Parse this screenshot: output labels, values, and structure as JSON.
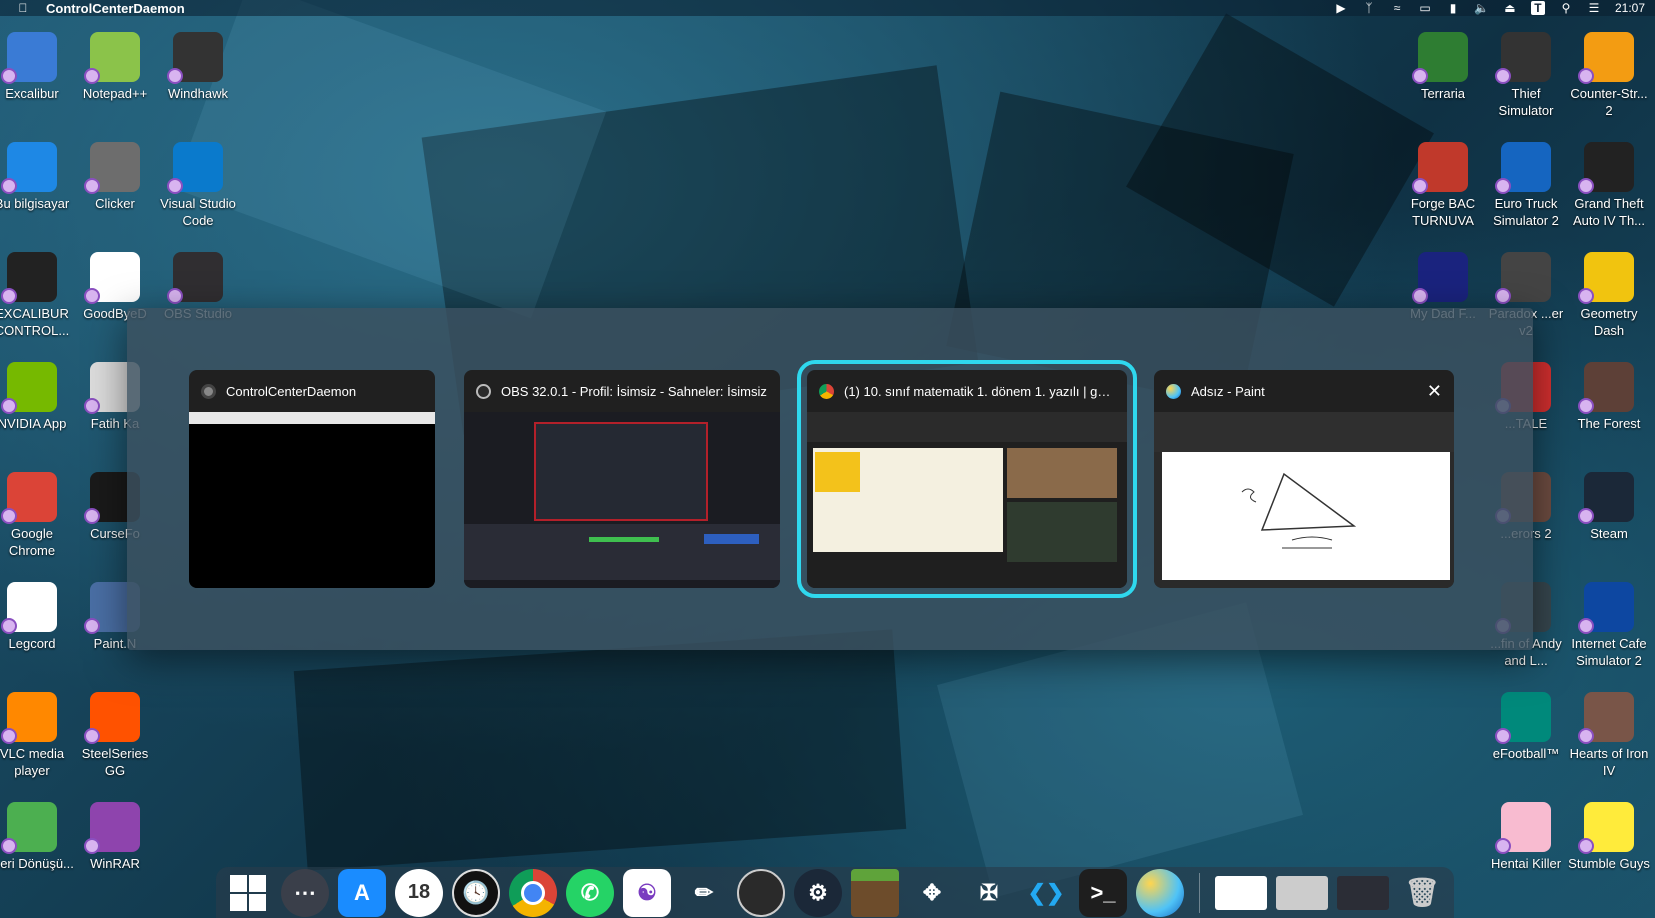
{
  "menubar": {
    "app_title": "ControlCenterDaemon",
    "clock": "21:07",
    "status_icons": [
      "play-circle-icon",
      "bluetooth-icon",
      "wifi-icon",
      "display-icon",
      "battery-icon",
      "volume-icon",
      "eject-icon",
      "keyboard-t-icon",
      "search-icon",
      "control-center-icon"
    ]
  },
  "desktop_left": [
    {
      "label": "Excalibur",
      "color": "#3a7bd5"
    },
    {
      "label": "Notepad++",
      "color": "#8bc34a"
    },
    {
      "label": "Windhawk",
      "color": "#333333"
    },
    {
      "label": "Bu bilgisayar",
      "color": "#1e88e5"
    },
    {
      "label": "Clicker",
      "color": "#6d6d6d"
    },
    {
      "label": "Visual Studio Code",
      "color": "#0a7acc"
    },
    {
      "label": "EXCALIBUR CONTROL...",
      "color": "#222222"
    },
    {
      "label": "GoodByeD",
      "color": "#ffffff"
    },
    {
      "label": "OBS Studio",
      "color": "#302e31"
    },
    {
      "label": "NVIDIA App",
      "color": "#76b900"
    },
    {
      "label": "Fatih Ka",
      "color": "#dddddd"
    },
    {
      "label": "Google Chrome",
      "color": "#db4437"
    },
    {
      "label": "CurseFo",
      "color": "#1a1a1a"
    },
    {
      "label": "Legcord",
      "color": "#ffffff"
    },
    {
      "label": "Paint.N",
      "color": "#4a6fa5"
    },
    {
      "label": "VLC media player",
      "color": "#ff8800"
    },
    {
      "label": "SteelSeries GG",
      "color": "#ff5200"
    },
    {
      "label": "Geri Dönüşü...",
      "color": "#4caf50"
    },
    {
      "label": "WinRAR",
      "color": "#8e44ad"
    }
  ],
  "desktop_right": [
    {
      "label": "Terraria",
      "color": "#2e7d32"
    },
    {
      "label": "Thief Simulator",
      "color": "#333333"
    },
    {
      "label": "Counter-Str... 2",
      "color": "#f39c12"
    },
    {
      "label": "Forge BAC TURNUVA",
      "color": "#c0392b"
    },
    {
      "label": "Euro Truck Simulator 2",
      "color": "#1565c0"
    },
    {
      "label": "Grand Theft Auto IV Th...",
      "color": "#222222"
    },
    {
      "label": "My Dad F...",
      "color": "#1a237e"
    },
    {
      "label": "Paradox ...er v2",
      "color": "#444444"
    },
    {
      "label": "Geometry Dash",
      "color": "#f1c40f"
    },
    {
      "label": "...TALE",
      "color": "#d32f2f"
    },
    {
      "label": "The Forest",
      "color": "#5d4037"
    },
    {
      "label": "...erors 2",
      "color": "#6d4c41"
    },
    {
      "label": "Steam",
      "color": "#1b2838"
    },
    {
      "label": "...fin of Andy and L...",
      "color": "#37474f"
    },
    {
      "label": "Internet Cafe Simulator 2",
      "color": "#0d47a1"
    },
    {
      "label": "eFootball™",
      "color": "#00897b"
    },
    {
      "label": "Hearts of Iron IV",
      "color": "#795548"
    },
    {
      "label": "Hentai Killer",
      "color": "#f8bbd0"
    },
    {
      "label": "Stumble Guys",
      "color": "#ffeb3b"
    }
  ],
  "switcher": {
    "windows": [
      {
        "title": "ControlCenterDaemon",
        "icon": "controlcenter-icon",
        "selected": false
      },
      {
        "title": "OBS 32.0.1 - Profil: İsimsiz - Sahneler: İsimsiz",
        "icon": "obs-icon",
        "selected": false
      },
      {
        "title": "(1) 10. sınıf matematik 1. dönem 1. yazılı | ge...",
        "icon": "chrome-icon",
        "selected": true
      },
      {
        "title": "Adsız - Paint",
        "icon": "paint-icon",
        "selected": false
      }
    ],
    "close_glyph": "✕"
  },
  "dock": {
    "calendar_day": "18",
    "items": [
      "windows-start-icon",
      "launchpad-icon",
      "app-store-icon",
      "calendar-icon",
      "clock-icon",
      "chrome-icon",
      "whatsapp-icon",
      "legcord-icon",
      "fatih-kalem-icon",
      "obs-icon",
      "steam-icon",
      "minecraft-icon",
      "windhawk-icon",
      "cursedforge-icon",
      "vscode-icon",
      "terminal-icon",
      "paint-icon"
    ],
    "thumbnails": [
      "paint-window-thumb",
      "chrome-window-thumb",
      "obs-window-thumb"
    ],
    "trash": "trash-icon"
  }
}
